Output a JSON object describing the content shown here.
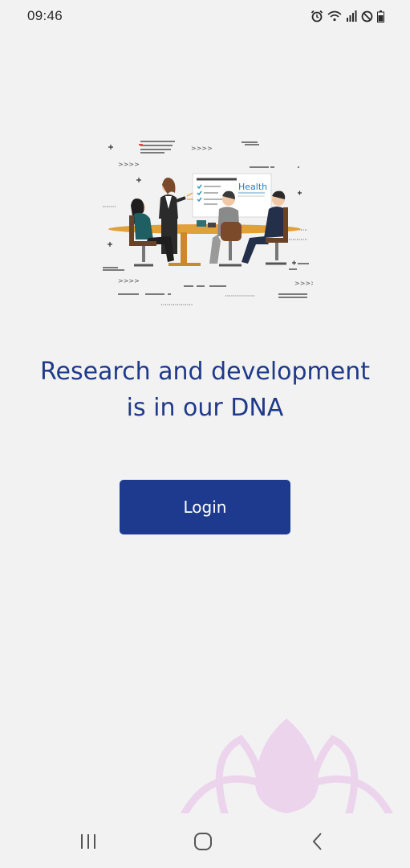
{
  "status_bar": {
    "time": "09:46",
    "icons": [
      "alarm-icon",
      "wifi-icon",
      "signal-icon",
      "do-not-disturb-icon",
      "battery-icon"
    ]
  },
  "main": {
    "tagline_line1": "Research and development",
    "tagline_line2": "is in our DNA",
    "login_label": "Login",
    "illustration_board_text": "Health"
  },
  "nav_bar": {
    "icons": [
      "recents-icon",
      "home-icon",
      "back-icon"
    ]
  },
  "colors": {
    "background": "#f2f2f2",
    "primary": "#1d3a8f",
    "tagline": "#1f3a8a",
    "lotus": "#e9d3ea"
  }
}
